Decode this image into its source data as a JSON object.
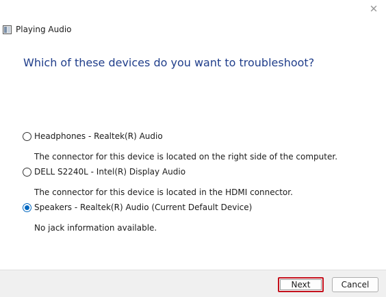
{
  "window": {
    "title": "Playing Audio",
    "close_glyph": "✕"
  },
  "heading": "Which of these devices do you want to troubleshoot?",
  "devices": [
    {
      "label": "Headphones - Realtek(R) Audio",
      "description": "The connector for this device is located on the right side of the computer.",
      "selected": false
    },
    {
      "label": "DELL S2240L - Intel(R) Display Audio",
      "description": "The connector for this device is located in the HDMI connector.",
      "selected": false
    },
    {
      "label": "Speakers - Realtek(R) Audio (Current Default Device)",
      "description": "No jack information available.",
      "selected": true
    }
  ],
  "buttons": {
    "next": "Next",
    "cancel": "Cancel"
  },
  "colors": {
    "heading": "#1f3d8a",
    "radio_selected": "#0067c0",
    "next_highlight": "#c4101c",
    "footer_bg": "#f0f0f0"
  }
}
